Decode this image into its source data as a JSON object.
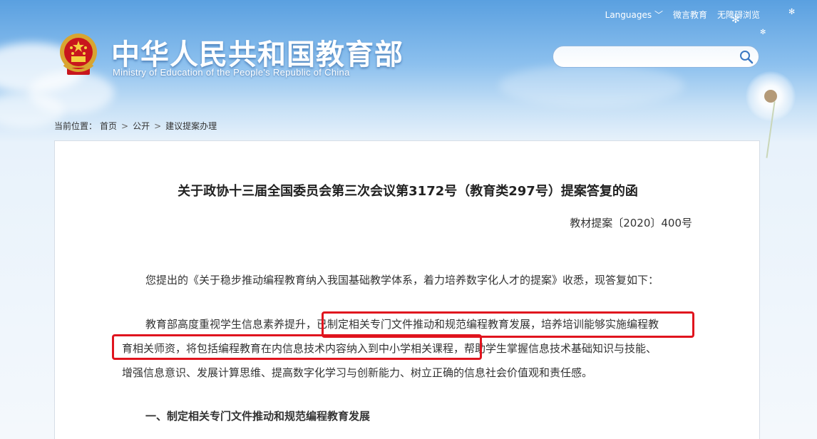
{
  "header": {
    "site_title_cn": "中华人民共和国教育部",
    "site_title_en": "Ministry of Education of the People's Republic of China",
    "top_links": {
      "languages": "Languages",
      "weibo": "微言教育",
      "accessibility": "无障碍浏览"
    },
    "search": {
      "placeholder": "",
      "value": ""
    }
  },
  "breadcrumb": {
    "label": "当前位置：",
    "items": [
      "首页",
      "公开",
      "建议提案办理"
    ]
  },
  "document": {
    "title": "关于政协十三届全国委员会第三次会议第3172号（教育类297号）提案答复的函",
    "number": "教材提案〔2020〕400号",
    "paragraph1": "您提出的《关于稳步推动编程教育纳入我国基础教学体系，着力培养数字化人才的提案》收悉，现答复如下：",
    "paragraph2_line1": "教育部高度重视学生信息素养提升，已制定相关专门文件推动和规范编程教育发展，培养培训能够实施编程教",
    "paragraph2_line2": "育相关师资，将包括编程教育在内信息技术内容纳入到中小学相关课程，帮助学生掌握信息技术基础知识与技能、",
    "paragraph2_line3": "增强信息意识、发展计算思维、提高数字化学习与创新能力、树立正确的信息社会价值观和责任感。",
    "section1_heading": "一、制定相关专门文件推动和规范编程教育发展"
  },
  "colors": {
    "highlight_border": "#e0141e",
    "sky_top": "#5aa0e0"
  }
}
